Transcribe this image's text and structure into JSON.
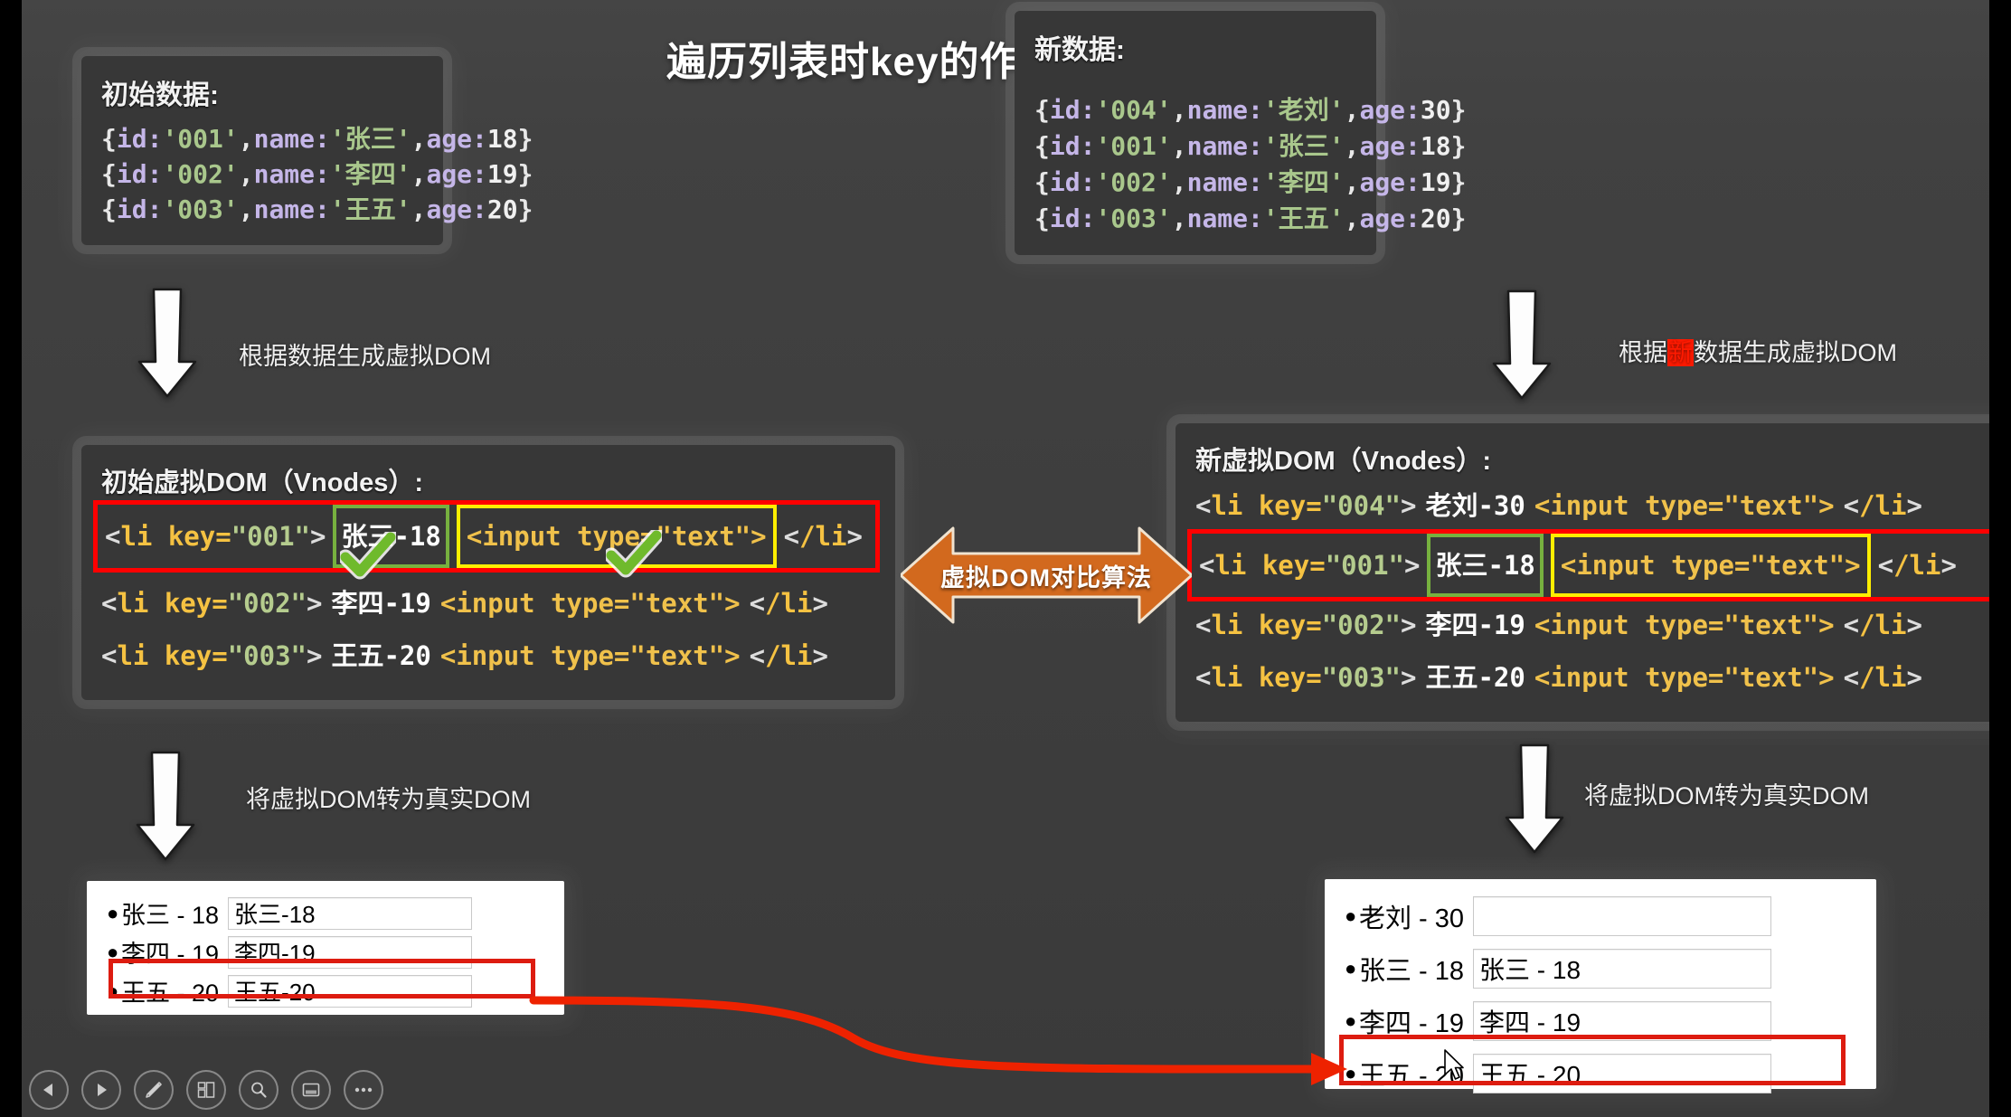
{
  "slide": {
    "title": "遍历列表时key的作用（id作为key）"
  },
  "data_initial": {
    "title": "初始数据:",
    "rows": [
      {
        "id": "'001'",
        "name": "'张三'",
        "age": "18"
      },
      {
        "id": "'002'",
        "name": "'李四'",
        "age": "19"
      },
      {
        "id": "'003'",
        "name": "'王五'",
        "age": "20"
      }
    ]
  },
  "data_new": {
    "title": "新数据:",
    "rows": [
      {
        "id": "'004'",
        "name": "'老刘'",
        "age": "30"
      },
      {
        "id": "'001'",
        "name": "'张三'",
        "age": "18"
      },
      {
        "id": "'002'",
        "name": "'李四'",
        "age": "19"
      },
      {
        "id": "'003'",
        "name": "'王五'",
        "age": "20"
      }
    ]
  },
  "arrows": {
    "gen_vdom_left": "根据数据生成虚拟DOM",
    "gen_vdom_right_pre": "根据",
    "gen_vdom_right_hl": "新",
    "gen_vdom_right_post": "数据生成虚拟DOM",
    "to_real_left": "将虚拟DOM转为真实DOM",
    "to_real_right": "将虚拟DOM转为真实DOM",
    "diff_label": "虚拟DOM对比算法"
  },
  "vdom_left": {
    "title": "初始虚拟DOM（Vnodes）:",
    "lines": [
      {
        "key": "\"001\"",
        "text": "张三-18",
        "input": "<input type=\"text\">",
        "highlight": true
      },
      {
        "key": "\"002\"",
        "text": "李四-19",
        "input": "<input type=\"text\">",
        "highlight": false
      },
      {
        "key": "\"003\"",
        "text": "王五-20",
        "input": "<input type=\"text\">",
        "highlight": false
      }
    ]
  },
  "vdom_right": {
    "title": "新虚拟DOM（Vnodes）:",
    "lines": [
      {
        "key": "\"004\"",
        "text": "老刘-30",
        "input": "<input type=\"text\">",
        "highlight": false
      },
      {
        "key": "\"001\"",
        "text": "张三-18",
        "input": "<input type=\"text\">",
        "highlight": true
      },
      {
        "key": "\"002\"",
        "text": "李四-19",
        "input": "<input type=\"text\">",
        "highlight": false
      },
      {
        "key": "\"003\"",
        "text": "王五-20",
        "input": "<input type=\"text\">",
        "highlight": false
      }
    ]
  },
  "real_left": {
    "rows": [
      {
        "label": "张三 - 18",
        "value": "张三-18",
        "highlight": false
      },
      {
        "label": "李四 - 19",
        "value": "李四-19",
        "highlight": false
      },
      {
        "label": "王五 - 20",
        "value": "王五-20",
        "highlight": true
      }
    ]
  },
  "real_right": {
    "rows": [
      {
        "label": "老刘 - 30",
        "value": "",
        "highlight": false
      },
      {
        "label": "张三 - 18",
        "value": "张三 - 18",
        "highlight": false
      },
      {
        "label": "李四 - 19",
        "value": "李四 - 19",
        "highlight": false
      },
      {
        "label": "王五 - 20",
        "value": "王五 - 20",
        "highlight": true
      }
    ]
  },
  "toolbar": {
    "items": [
      {
        "icon": "prev-icon",
        "label": "上一页"
      },
      {
        "icon": "next-icon",
        "label": "下一页"
      },
      {
        "icon": "pen-icon",
        "label": "画笔"
      },
      {
        "icon": "slides-icon",
        "label": "幻灯片总览"
      },
      {
        "icon": "search-icon",
        "label": "搜索"
      },
      {
        "icon": "presenter-icon",
        "label": "演讲者视图"
      },
      {
        "icon": "more-icon",
        "label": "更多"
      }
    ]
  },
  "colors": {
    "slide_bg": "#3f3f3f",
    "panel_bg": "#373737",
    "accent_orange": "#d2691e",
    "highlight_red": "#ff0000",
    "highlight_green": "#77b13f",
    "highlight_yellow": "#ffee00",
    "connector_red": "#ee2200"
  }
}
